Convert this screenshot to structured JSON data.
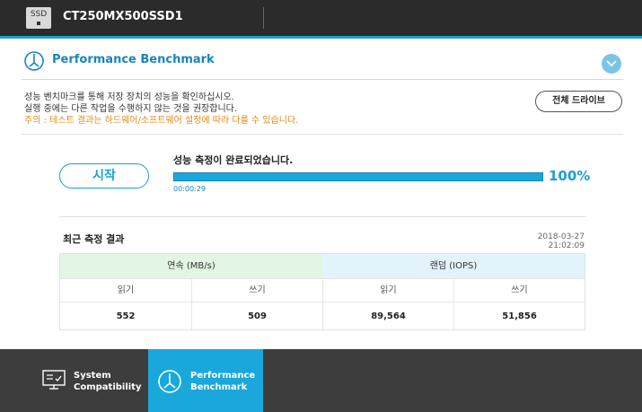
{
  "topbar": {
    "drive_icon_label": "SSD",
    "drive_name": "CT250MX500SSD1"
  },
  "section": {
    "title": "Performance Benchmark"
  },
  "description": {
    "line1": "성능 벤치마크를 통해 저장 장치의 성능을 확인하십시오.",
    "line2": "실행 중에는 다른 작업을 수행하지 않는 것을 권장합니다.",
    "warning": "주의 : 테스트 결과는 하드웨어/소프트웨어 설정에 따라 다를 수 있습니다."
  },
  "buttons": {
    "all_drives": "전체 드라이브",
    "start": "시작"
  },
  "progress": {
    "status": "성능 측정이 완료되었습니다.",
    "elapsed": "00:00:29",
    "percent_label": "100%",
    "fraction": 1.0
  },
  "results": {
    "title": "최근 측정 결과",
    "timestamp": "2018-03-27 21:02:09",
    "sequential_header": "연속 (MB/s)",
    "random_header": "랜덤 (IOPS)",
    "read_label": "읽기",
    "write_label": "쓰기",
    "seq_read": "552",
    "seq_write": "509",
    "rnd_read": "89,564",
    "rnd_write": "51,856"
  },
  "nav": {
    "items": [
      {
        "label": "System Compatibility",
        "line1": "System",
        "line2": "Compatibility",
        "icon": "checklist-monitor-icon",
        "active": false
      },
      {
        "label": "Performance Benchmark",
        "line1": "Performance",
        "line2": "Benchmark",
        "icon": "gauge-icon",
        "active": true
      }
    ]
  },
  "colors": {
    "accent": "#1aa7dc",
    "topbar": "#2b2b2b",
    "warning": "#e48a14",
    "nav_bg": "#3d3d3d",
    "seq_header_bg": "#e3f5e3",
    "rnd_header_bg": "#e2f3fb"
  }
}
